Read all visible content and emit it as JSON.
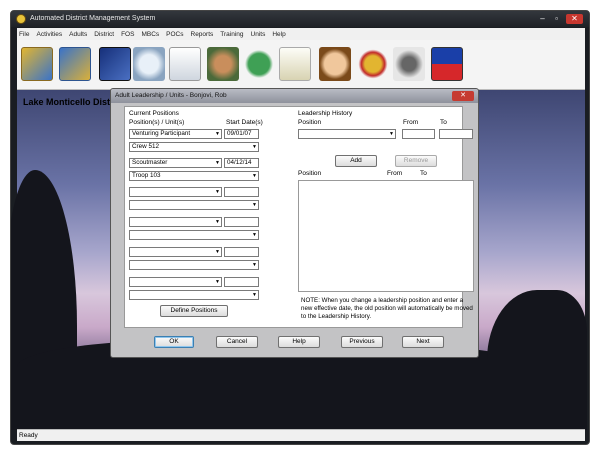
{
  "window": {
    "title": "Automated District Management System",
    "min": "–",
    "max": "▫",
    "close": "✕"
  },
  "menu": [
    "File",
    "Activities",
    "Adults",
    "District",
    "FOS",
    "MBCs",
    "POCs",
    "Reports",
    "Training",
    "Units",
    "Help"
  ],
  "toolbar": {
    "icons": [
      "beaver-icon",
      "cub-icon",
      "book-icon",
      "magnifier-icon",
      "notebook-icon",
      "meeting-icon",
      "fleur-de-lis-icon",
      "certificate-icon",
      "person-face-icon",
      "medal-icon",
      "phone-icon",
      "flag-icon"
    ]
  },
  "district_name": "Lake Monticello District",
  "status": "Ready",
  "dialog": {
    "title": "Adult Leadership / Units - Bonjovi,  Rob",
    "close": "✕",
    "current_positions": {
      "heading": "Current Positions",
      "col_position": "Position(s) / Unit(s)",
      "col_start": "Start Date(s)",
      "rows": [
        {
          "position": "Venturing Participant",
          "date": "09/01/07",
          "unit": "Crew 512"
        },
        {
          "position": "Scoutmaster",
          "date": "04/12/14",
          "unit": "Troop 103"
        },
        {
          "position": "",
          "date": "",
          "unit": ""
        },
        {
          "position": "",
          "date": "",
          "unit": ""
        },
        {
          "position": "",
          "date": "",
          "unit": ""
        },
        {
          "position": "",
          "date": "",
          "unit": ""
        }
      ],
      "define_button": "Define Positions"
    },
    "history": {
      "heading": "Leadership History",
      "position_label": "Position",
      "from_label": "From",
      "to_label": "To",
      "add_button": "Add",
      "remove_button": "Remove",
      "list_position": "Position",
      "list_from": "From",
      "list_to": "To",
      "note": "NOTE: When you change a leadership position and enter a new effective date, the old position will automatically be moved to the Leadership History."
    },
    "buttons": {
      "ok": "OK",
      "cancel": "Cancel",
      "help": "Help",
      "previous": "Previous",
      "next": "Next"
    }
  }
}
